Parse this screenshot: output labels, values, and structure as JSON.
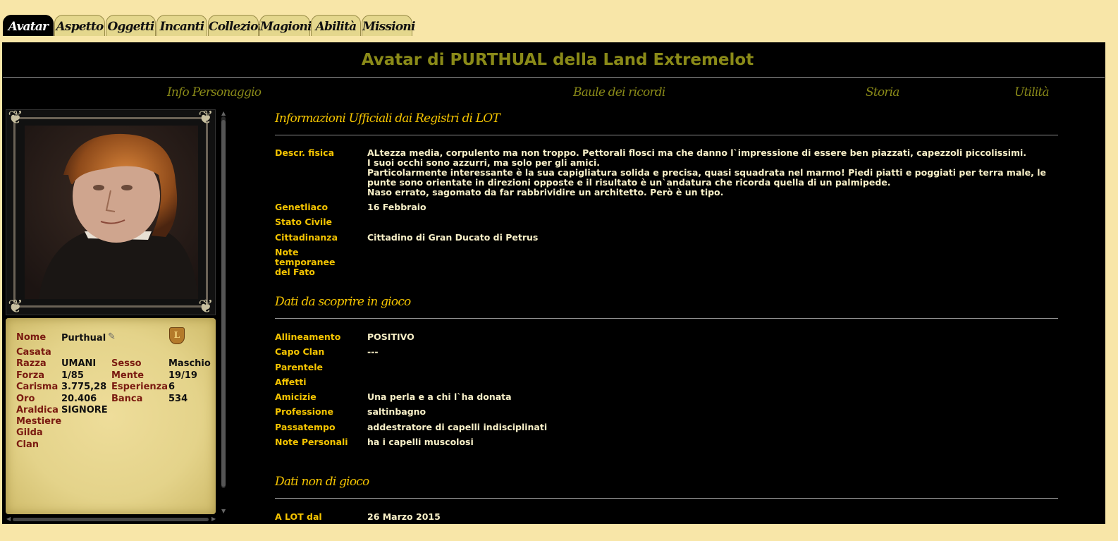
{
  "tabs": [
    "Avatar",
    "Aspetto",
    "Oggetti",
    "Incanti",
    "Collezioni",
    "Magioni",
    "Abilità",
    "Missioni"
  ],
  "title": "Avatar di PURTHUAL della Land Extremelot",
  "nav": {
    "info": "Info Personaggio",
    "baule": "Baule dei ricordi",
    "storia": "Storia",
    "utilita": "Utilità"
  },
  "profile": {
    "nome_label": "Nome",
    "nome": "Purthual",
    "casata_label": "Casata",
    "razza_label": "Razza",
    "razza": "UMANI",
    "sesso_label": "Sesso",
    "sesso": "Maschio",
    "forza_label": "Forza",
    "forza": "1/85",
    "mente_label": "Mente",
    "mente": "19/19",
    "carisma_label": "Carisma",
    "carisma": "3.775,28",
    "esperienza_label": "Esperienza",
    "esperienza": "6",
    "oro_label": "Oro",
    "oro": "20.406",
    "banca_label": "Banca",
    "banca": "534",
    "araldica_label": "Araldica",
    "araldica": "SIGNORE",
    "mestiere_label": "Mestiere",
    "gilda_label": "Gilda",
    "clan_label": "Clan",
    "shield_text": "L"
  },
  "sections": {
    "ufficiali": "Informazioni Ufficiali dai Registri di LOT",
    "scoprire": "Dati da scoprire in gioco",
    "nongioco": "Dati non di gioco"
  },
  "ufficiali": {
    "descr_label": "Descr. fisica",
    "descr": "ALtezza media, corpulento ma non troppo. Pettorali flosci ma che danno l`impressione di essere ben piazzati, capezzoli piccolissimi.\nI suoi occhi sono azzurri, ma solo per gli amici.\nParticolarmente interessante è la sua capigliatura solida e precisa, quasi squadrata nel marmo! Piedi piatti e poggiati per terra male, le punte sono orientate in direzioni opposte e il risultato è un`andatura che ricorda quella di un palmipede.\nNaso errato, sagomato da far rabbrividire un architetto. Però è un tipo.",
    "genetliaco_label": "Genetliaco",
    "genetliaco": "16 Febbraio",
    "stato_label": "Stato Civile",
    "cittadinanza_label": "Cittadinanza",
    "cittadinanza": "Cittadino di Gran Ducato di Petrus",
    "note_label": "Note temporanee\ndel Fato"
  },
  "scoprire": {
    "allineamento_label": "Allineamento",
    "allineamento": "POSITIVO",
    "capoclan_label": "Capo Clan",
    "capoclan": "---",
    "parentele_label": "Parentele",
    "affetti_label": "Affetti",
    "amicizie_label": "Amicizie",
    "amicizie": "Una perla e a chi l`ha donata",
    "professione_label": "Professione",
    "professione": "saltinbagno",
    "passatempo_label": "Passatempo",
    "passatempo": "addestratore di capelli indisciplinati",
    "notepers_label": "Note Personali",
    "notepers": "ha i capelli muscolosi"
  },
  "nongioco": {
    "lotdal_label": "A LOT dal",
    "lotdal": "26 Marzo 2015"
  }
}
